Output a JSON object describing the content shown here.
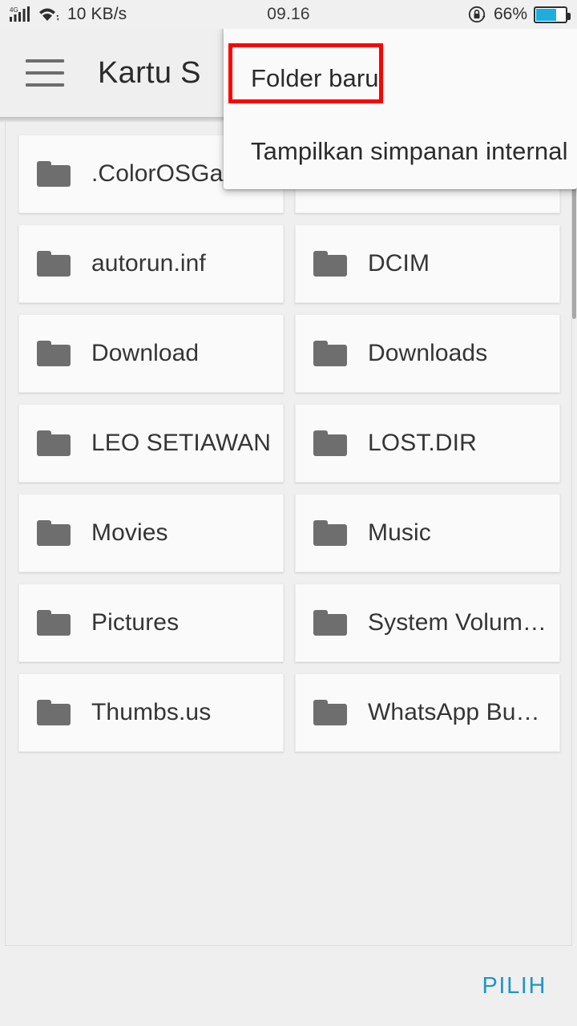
{
  "status_bar": {
    "network_type": "4G",
    "signal_icon": "signal-bars-icon",
    "wifi_icon": "wifi-icon",
    "network_speed": "10 KB/s",
    "clock": "09.16",
    "rotation_lock_icon": "rotation-lock-icon",
    "battery_percent": "66%",
    "battery_level": 66,
    "battery_color": "#1eaedb"
  },
  "app_bar": {
    "menu_icon": "hamburger-menu-icon",
    "title": "Kartu S"
  },
  "popup_menu": {
    "items": [
      {
        "label": "Folder baru",
        "highlighted": true
      },
      {
        "label": "Tampilkan simpanan internal",
        "highlighted": false
      }
    ],
    "highlight_color": "#fe0000"
  },
  "file_grid": {
    "folder_icon": "folder-icon",
    "items": [
      {
        "name": ".ColorOSGal",
        "type": "folder"
      },
      {
        "name": "",
        "type": "folder"
      },
      {
        "name": "autorun.inf",
        "type": "folder"
      },
      {
        "name": "DCIM",
        "type": "folder"
      },
      {
        "name": "Download",
        "type": "folder"
      },
      {
        "name": "Downloads",
        "type": "folder"
      },
      {
        "name": "LEO SETIAWAN",
        "type": "folder"
      },
      {
        "name": "LOST.DIR",
        "type": "folder"
      },
      {
        "name": "Movies",
        "type": "folder"
      },
      {
        "name": "Music",
        "type": "folder"
      },
      {
        "name": "Pictures",
        "type": "folder"
      },
      {
        "name": "System Volum…",
        "type": "folder"
      },
      {
        "name": "Thumbs.us",
        "type": "folder"
      },
      {
        "name": "WhatsApp Bu…",
        "type": "folder"
      }
    ]
  },
  "bottom_bar": {
    "select_label": "PILIH",
    "accent_color": "#2196c4"
  }
}
